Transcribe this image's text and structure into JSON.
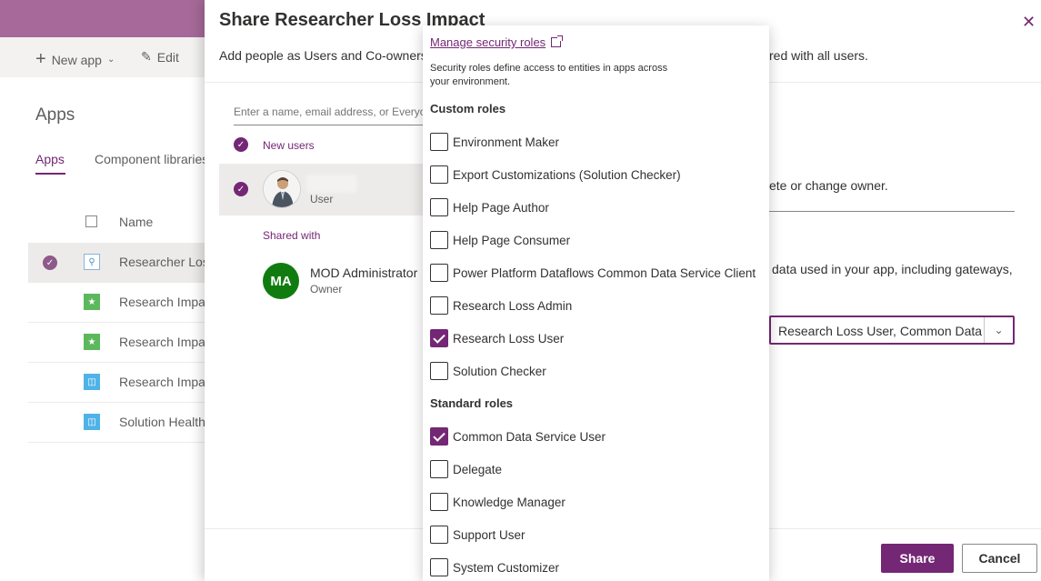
{
  "background": {
    "toolbar": {
      "new_app": "New app",
      "edit": "Edit"
    },
    "page_title": "Apps",
    "tabs": [
      "Apps",
      "Component libraries"
    ],
    "column_name": "Name",
    "rows": [
      "Researcher Loss Impact",
      "Research Impact",
      "Research Impact",
      "Research Impact",
      "Solution Health"
    ]
  },
  "panel": {
    "title": "Share Researcher Loss Impact",
    "subtitle": "Add people as Users and Co-owners",
    "subtitle_right": "red with all users.",
    "search_placeholder": "Enter a name, email address, or Everyone",
    "new_users_label": "New users",
    "user_role": "User",
    "shared_with_label": "Shared with",
    "owner": {
      "initials": "MA",
      "name": "MOD Administrator",
      "role": "Owner"
    },
    "right_text_1": "ete or change owner.",
    "right_text_2": "data used in your app, including gateways,",
    "selected_roles": "Research Loss User, Common Data Service User",
    "share_button": "Share",
    "cancel_button": "Cancel"
  },
  "dropdown": {
    "manage_link": "Manage security roles",
    "description": "Security roles define access to entities in apps across your environment.",
    "custom_heading": "Custom roles",
    "custom_roles": [
      {
        "label": "Environment Maker",
        "checked": false
      },
      {
        "label": "Export Customizations (Solution Checker)",
        "checked": false
      },
      {
        "label": "Help Page Author",
        "checked": false
      },
      {
        "label": "Help Page Consumer",
        "checked": false
      },
      {
        "label": "Power Platform Dataflows Common Data Service Client",
        "checked": false
      },
      {
        "label": "Research Loss Admin",
        "checked": false
      },
      {
        "label": "Research Loss User",
        "checked": true
      },
      {
        "label": "Solution Checker",
        "checked": false
      }
    ],
    "standard_heading": "Standard roles",
    "standard_roles": [
      {
        "label": "Common Data Service User",
        "checked": true
      },
      {
        "label": "Delegate",
        "checked": false
      },
      {
        "label": "Knowledge Manager",
        "checked": false
      },
      {
        "label": "Support User",
        "checked": false
      },
      {
        "label": "System Customizer",
        "checked": false
      }
    ]
  },
  "colors": {
    "accent": "#742774",
    "header": "#a66999",
    "owner_avatar": "#107c10"
  }
}
